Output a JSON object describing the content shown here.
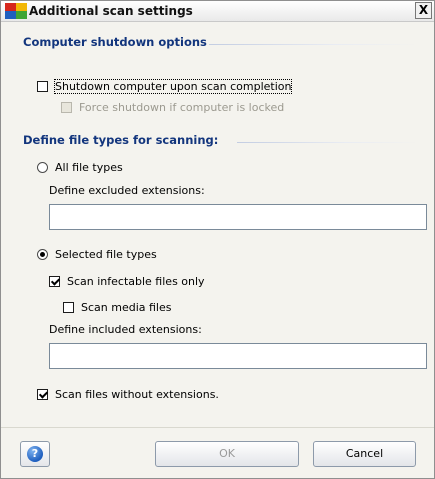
{
  "window": {
    "title": "Additional scan settings",
    "close_glyph": "X"
  },
  "shutdown_section": {
    "heading": "Computer shutdown options",
    "shutdown_label": "Shutdown computer upon scan completion",
    "shutdown_checked": false,
    "force_label": "Force shutdown if computer is locked",
    "force_checked": false,
    "force_enabled": false
  },
  "filetypes_section": {
    "heading": "Define file types for scanning:",
    "all_types_label": "All file types",
    "all_types_selected": false,
    "excluded_label": "Define excluded extensions:",
    "excluded_value": "",
    "selected_types_label": "Selected file types",
    "selected_types_selected": true,
    "infectable_label": "Scan infectable files only",
    "infectable_checked": true,
    "media_label": "Scan media files",
    "media_checked": false,
    "included_label": "Define included extensions:",
    "included_value": "",
    "no_ext_label": "Scan files without extensions.",
    "no_ext_checked": true
  },
  "buttons": {
    "help_glyph": "?",
    "ok_label": "OK",
    "ok_enabled": false,
    "cancel_label": "Cancel"
  },
  "colors": {
    "section_heading": "#12357d",
    "window_bg": "#f4f3ee",
    "brand_red": "#d6261c",
    "brand_yellow": "#f2b705",
    "brand_blue": "#1f5fbf",
    "brand_green": "#3fa535"
  }
}
